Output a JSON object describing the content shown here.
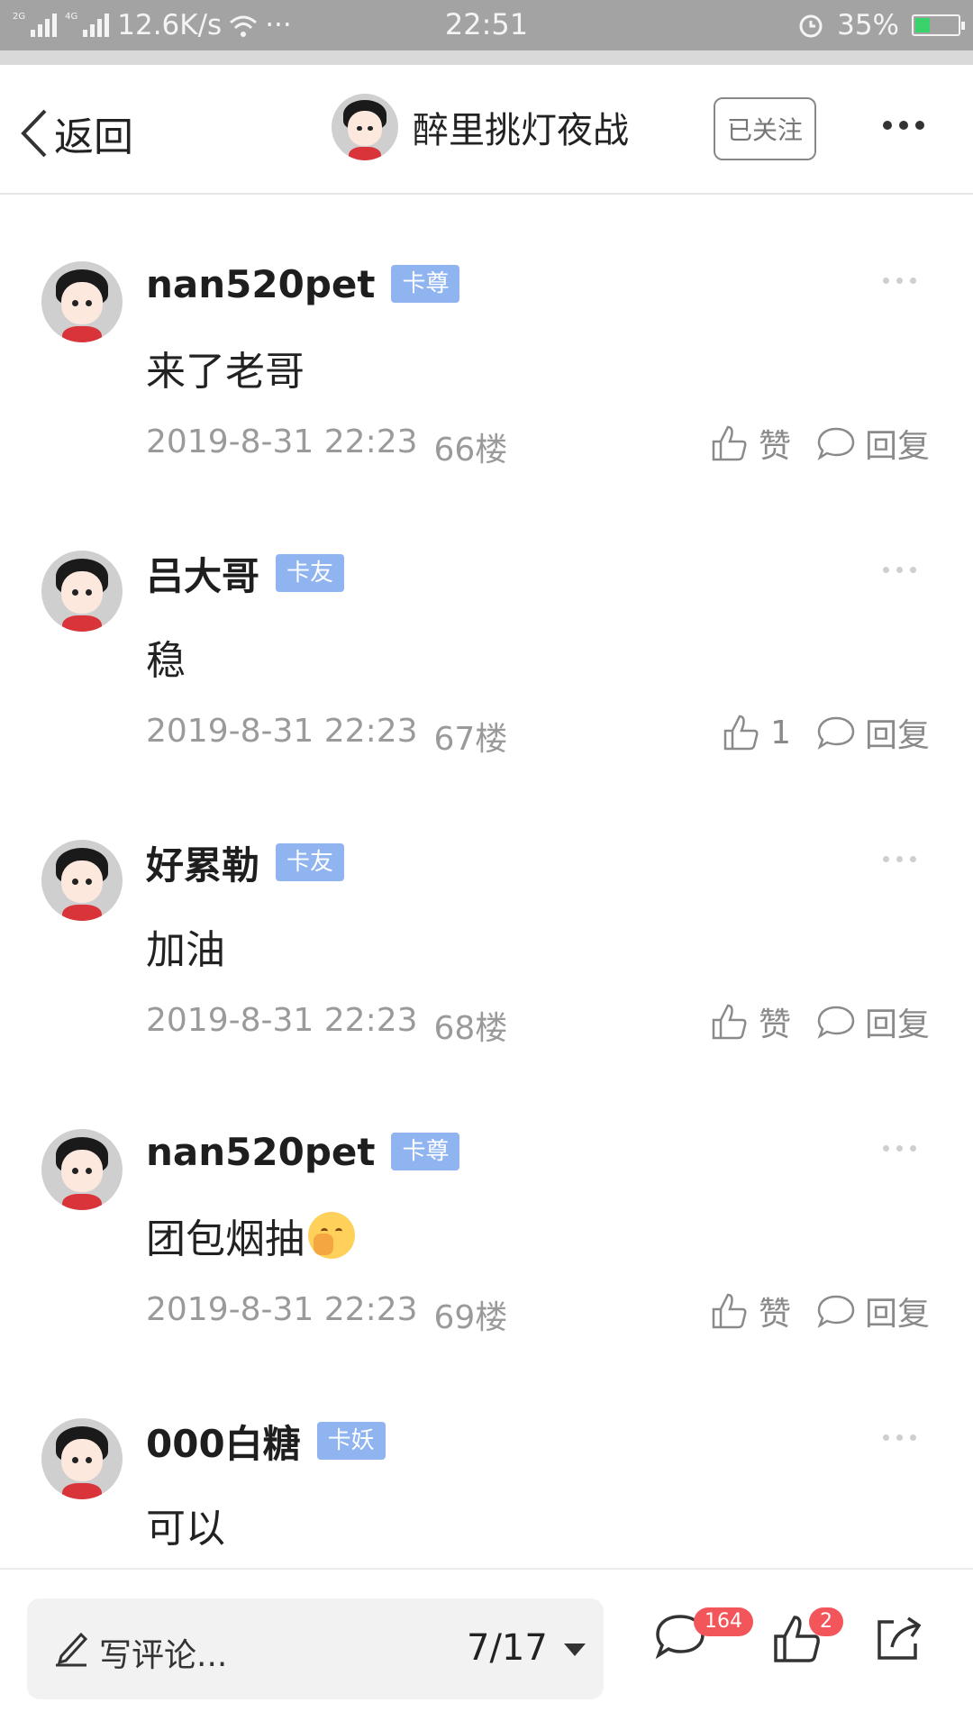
{
  "status_bar": {
    "net_2g": "2G",
    "net_4g": "4G",
    "speed": "12.6K/s",
    "dots": "···",
    "time": "22:51",
    "battery": "35%",
    "battery_level": 0.35,
    "battery_color": "#3ad26a"
  },
  "nav": {
    "back_label": "返回",
    "author_name": "醉里挑灯夜战",
    "follow_label": "已关注"
  },
  "posts": [
    {
      "user": "nan520pet",
      "badge": "卡尊",
      "content": "来了老哥",
      "time": "2019-8-31 22:23",
      "floor": "66楼",
      "like": "赞",
      "reply": "回复"
    },
    {
      "user": "吕大哥",
      "badge": "卡友",
      "content": "稳",
      "time": "2019-8-31 22:23",
      "floor": "67楼",
      "like": "1",
      "reply": "回复"
    },
    {
      "user": "好累勒",
      "badge": "卡友",
      "content": "加油",
      "time": "2019-8-31 22:23",
      "floor": "68楼",
      "like": "赞",
      "reply": "回复"
    },
    {
      "user": "nan520pet",
      "badge": "卡尊",
      "content": "团包烟抽",
      "content_emoji": "shushing-face-emoji",
      "time": "2019-8-31 22:23",
      "floor": "69楼",
      "like": "赞",
      "reply": "回复"
    },
    {
      "user": "000白糖",
      "badge": "卡妖",
      "content": "可以"
    }
  ],
  "bottom_bar": {
    "comment_placeholder": "写评论...",
    "page_indicator": "7/17",
    "comment_count": "164",
    "like_count": "2"
  },
  "colors": {
    "badge": "#8fb4ef",
    "count_badge": "#f2555a",
    "status_bar": "#a3a3a3"
  }
}
